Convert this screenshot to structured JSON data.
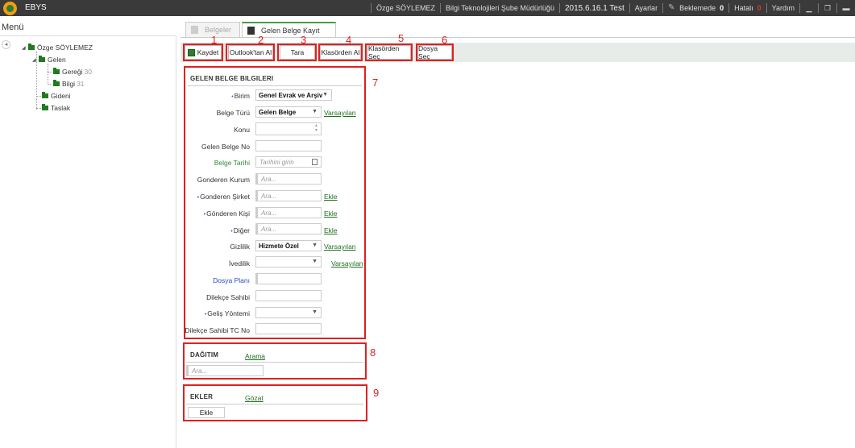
{
  "app": {
    "title": "EBYS",
    "user": "Özge SÖYLEMEZ",
    "department": "Bilgi Teknolojileri Şube Müdürlüğü",
    "version": "2015.6.16.1 Test",
    "settings_label": "Ayarlar",
    "pending_label": "Beklemede",
    "pending_count": "0",
    "error_label": "Hatalı",
    "error_count": "0",
    "help_label": "Yardım"
  },
  "menu": {
    "title": "Menü",
    "tree": [
      {
        "label": "Özge SÖYLEMEZ",
        "count": ""
      },
      {
        "label": "Gelen",
        "count": ""
      },
      {
        "label": "Gereği",
        "count": "30"
      },
      {
        "label": "Bilgi",
        "count": "31"
      },
      {
        "label": "Gideni",
        "count": ""
      },
      {
        "label": "Taslak",
        "count": ""
      }
    ]
  },
  "tabs": [
    {
      "label": "Belgeler"
    },
    {
      "label": "Gelen Belge Kayıt"
    }
  ],
  "toolbar": {
    "buttons": [
      {
        "label": "Kaydet",
        "num": "1"
      },
      {
        "label": "Outlook'tan Al",
        "num": "2"
      },
      {
        "label": "Tara",
        "num": "3"
      },
      {
        "label": "Klasörden Al",
        "num": "4"
      },
      {
        "label": "Klasörden Seç",
        "num": "5"
      },
      {
        "label": "Dosya Seç",
        "num": "6"
      }
    ]
  },
  "form": {
    "section_title": "GELEN BELGE BILGILERI",
    "section_num": "7",
    "fields": {
      "birim": {
        "label": "Birim",
        "value": "Genel Evrak ve Arşiv"
      },
      "belge_turu": {
        "label": "Belge Türü",
        "value": "Gelen Belge",
        "link": "Varsayılan"
      },
      "konu": {
        "label": "Konu"
      },
      "gelen_belge_no": {
        "label": "Gelen Belge No"
      },
      "belge_tarihi": {
        "label": "Belge Tarihi",
        "placeholder": "Tarihini girin"
      },
      "gonderen_kurum": {
        "label": "Gonderen Kurum",
        "placeholder": "Ara..."
      },
      "gonderen_sirket": {
        "label": "Gonderen Şirket",
        "placeholder": "Ara...",
        "link": "Ekle"
      },
      "gonderen_kisi": {
        "label": "Gönderen Kişi",
        "placeholder": "Ara...",
        "link": "Ekle"
      },
      "diger": {
        "label": "Diğer",
        "placeholder": "Ara...",
        "link": "Ekle"
      },
      "gizlilik": {
        "label": "Gizlilik",
        "value": "Hizmete Özel",
        "link": "Varsayılan"
      },
      "ivedilik": {
        "label": "İvedilik",
        "value": "",
        "link": "Varsayılan"
      },
      "dosya_plani": {
        "label": "Dosya Planı"
      },
      "dilekce_sahibi": {
        "label": "Dilekçe Sahibi"
      },
      "gelis_yontemi": {
        "label": "Geliş Yöntemi",
        "value": ""
      },
      "dilekce_tc": {
        "label": "Dilekçe Sahibi TC No"
      }
    }
  },
  "dagitim": {
    "title": "DAĞITIM",
    "link": "Arama",
    "placeholder": "Ara...",
    "num": "8"
  },
  "ekler": {
    "title": "EKLER",
    "link": "Gözat",
    "button": "Ekle",
    "num": "9"
  },
  "colors": {
    "topbar": "#3a3a3a",
    "accent_green": "#2e7d32",
    "annotation_red": "#e02020"
  }
}
